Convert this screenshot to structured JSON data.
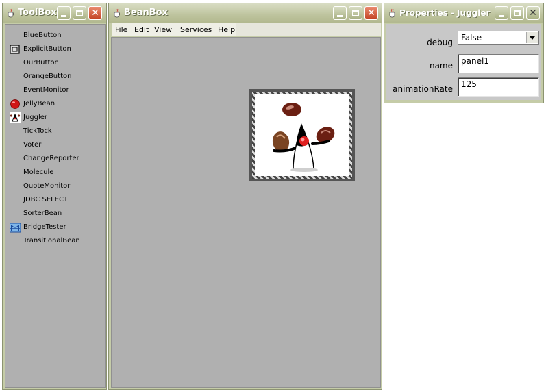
{
  "toolbox": {
    "title": "ToolBox",
    "items": [
      {
        "label": "BlueButton",
        "icon": "none"
      },
      {
        "label": "ExplicitButton",
        "icon": "square-button-icon"
      },
      {
        "label": "OurButton",
        "icon": "none"
      },
      {
        "label": "OrangeButton",
        "icon": "none"
      },
      {
        "label": "EventMonitor",
        "icon": "none"
      },
      {
        "label": "JellyBean",
        "icon": "jellybean-icon"
      },
      {
        "label": "Juggler",
        "icon": "juggler-icon"
      },
      {
        "label": "TickTock",
        "icon": "none"
      },
      {
        "label": "Voter",
        "icon": "none"
      },
      {
        "label": "ChangeReporter",
        "icon": "none"
      },
      {
        "label": "Molecule",
        "icon": "none"
      },
      {
        "label": "QuoteMonitor",
        "icon": "none"
      },
      {
        "label": "JDBC SELECT",
        "icon": "none"
      },
      {
        "label": "SorterBean",
        "icon": "none"
      },
      {
        "label": "BridgeTester",
        "icon": "bridge-icon"
      },
      {
        "label": "TransitionalBean",
        "icon": "none"
      }
    ]
  },
  "beanbox": {
    "title": "BeanBox",
    "menu": [
      "File",
      "Edit",
      "View",
      "Services",
      "Help"
    ]
  },
  "properties": {
    "title": "Properties - Juggler",
    "rows": [
      {
        "label": "debug",
        "value": "False"
      },
      {
        "label": "name",
        "value": "panel1"
      },
      {
        "label": "animationRate",
        "value": "125"
      }
    ]
  },
  "colors": {
    "window_frame": "#c5cca8",
    "panel_gray": "#b0b0b0",
    "close_button": "#c44426"
  }
}
